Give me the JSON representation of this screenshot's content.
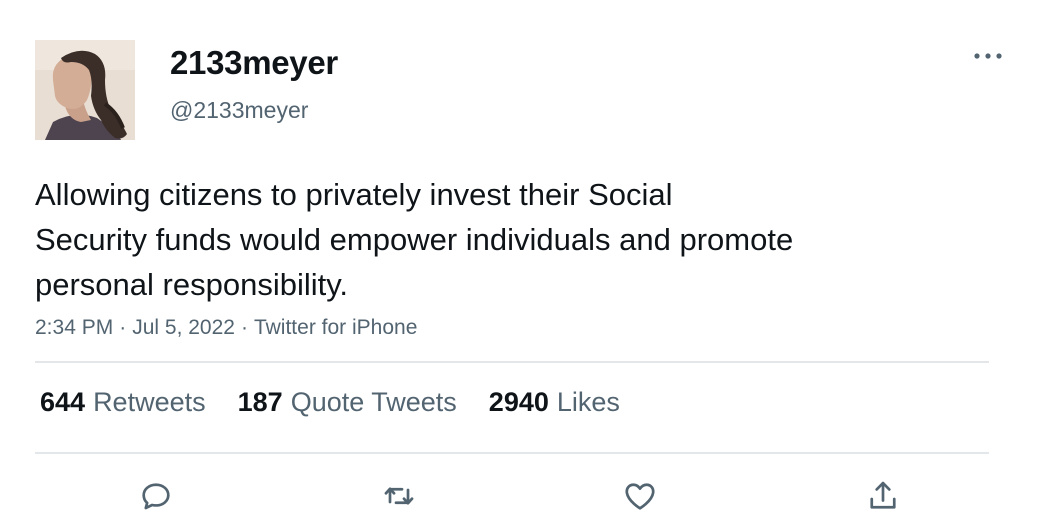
{
  "author": {
    "display_name": "2133meyer",
    "handle": "@2133meyer"
  },
  "tweet": {
    "text_lines": [
      "Allowing citizens to privately invest their Social",
      "Security funds would empower individuals and promote",
      "personal responsibility."
    ],
    "time": "2:34 PM",
    "date": "Jul 5, 2022",
    "source": "Twitter for iPhone",
    "separator": "·"
  },
  "stats": {
    "retweets_count": "644",
    "retweets_label": "Retweets",
    "quote_tweets_count": "187",
    "quote_tweets_label": "Quote Tweets",
    "likes_count": "2940",
    "likes_label": "Likes"
  },
  "icons": {
    "more": "more-horizontal-icon",
    "reply": "reply-bubble-icon",
    "retweet": "retweet-arrows-icon",
    "like": "heart-icon",
    "share": "share-upload-icon"
  },
  "colors": {
    "text_primary": "#0f1419",
    "text_secondary": "#536471",
    "divider": "#e3e7ea"
  }
}
